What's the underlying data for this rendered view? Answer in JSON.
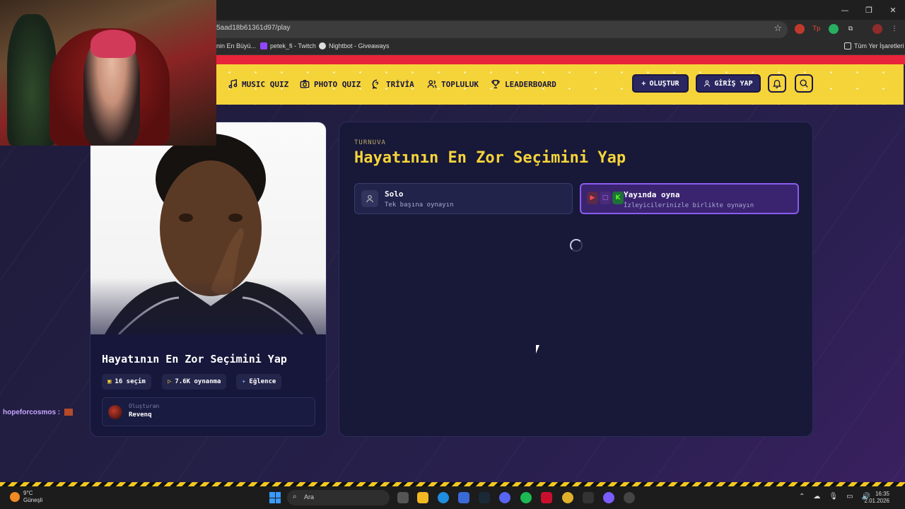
{
  "browser": {
    "url": "5aad18b61361d97/play",
    "bookmarks": [
      {
        "label": "nin En Büyü..."
      },
      {
        "label": "petek_fi - Twitch"
      },
      {
        "label": "Nightbot - Giveaways"
      }
    ],
    "all_bookmarks_label": "Tüm Yer İşaretleri"
  },
  "nav": {
    "items": [
      {
        "label": "MUSIC QUIZ",
        "icon": "music-note-icon"
      },
      {
        "label": "PHOTO QUIZ",
        "icon": "camera-icon"
      },
      {
        "label": "TRİVİA",
        "icon": "chat-question-icon"
      },
      {
        "label": "TOPLULUK",
        "icon": "users-icon"
      },
      {
        "label": "LEADERBOARD",
        "icon": "trophy-icon"
      }
    ],
    "create_label": "OLUŞTUR",
    "login_label": "GİRİŞ YAP"
  },
  "quiz_card": {
    "title": "Hayatının En Zor Seçimini Yap",
    "choices": "16 seçim",
    "plays": "7.6K oynanma",
    "category": "Eğlence",
    "creator_label": "Oluşturan",
    "creator_name": "Revenq"
  },
  "main": {
    "kicker": "TURNUVA",
    "title": "Hayatının En Zor Seçimini Yap",
    "solo": {
      "title": "Solo",
      "subtitle": "Tek başına oynayın"
    },
    "live": {
      "title": "Yayında oyna",
      "subtitle": "İzleyicilerinizle birlikte oynayın"
    }
  },
  "chat": {
    "user": "hopeforcosmos :"
  },
  "taskbar": {
    "temp": "9°C",
    "weather": "Güneşli",
    "search_placeholder": "Ara",
    "time": "16:35",
    "date": "2.01.2026"
  },
  "colors": {
    "nav_bg": "#f5d43a",
    "accent_yellow": "#f5d43a",
    "panel_bg": "#181838",
    "live_border": "#8a5cf0",
    "top_strip": "#e8243a"
  }
}
